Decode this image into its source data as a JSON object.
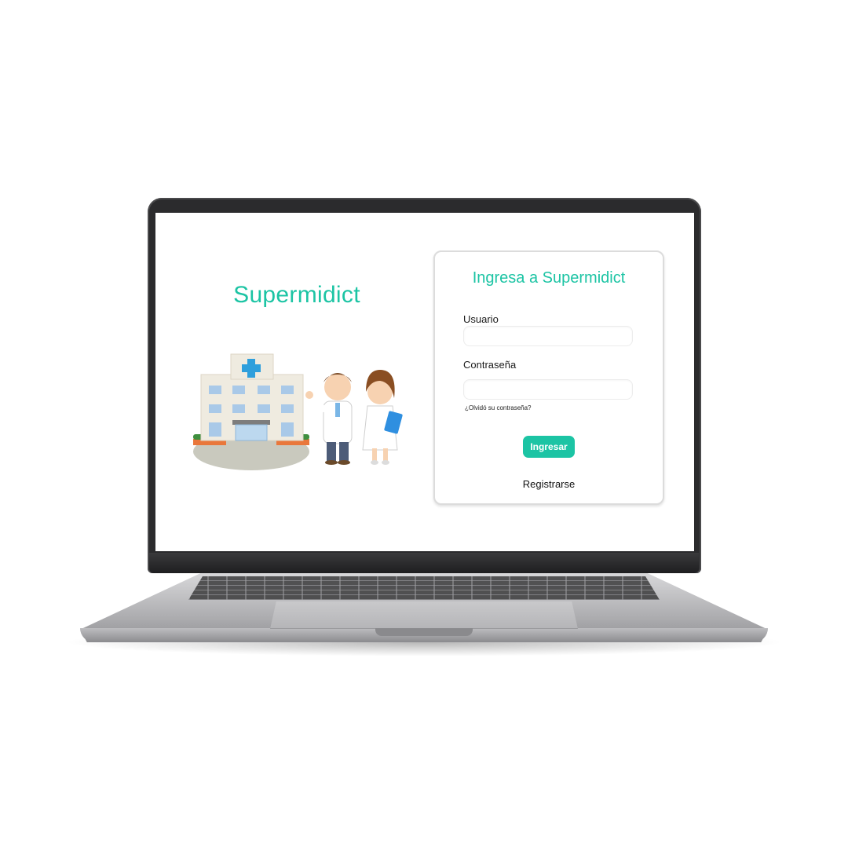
{
  "app": {
    "accent": "#1cc4a4"
  },
  "brand": {
    "title": "Supermidict"
  },
  "illustration": {
    "icon": "hospital-with-doctor-and-nurse-illustration"
  },
  "login": {
    "title": "Ingresa a Supermidict",
    "username_label": "Usuario",
    "username_value": "",
    "password_label": "Contraseña",
    "password_value": "",
    "forgot_link": "¿Olvidó su contraseña?",
    "submit_label": "Ingresar",
    "register_link": "Registrarse"
  }
}
